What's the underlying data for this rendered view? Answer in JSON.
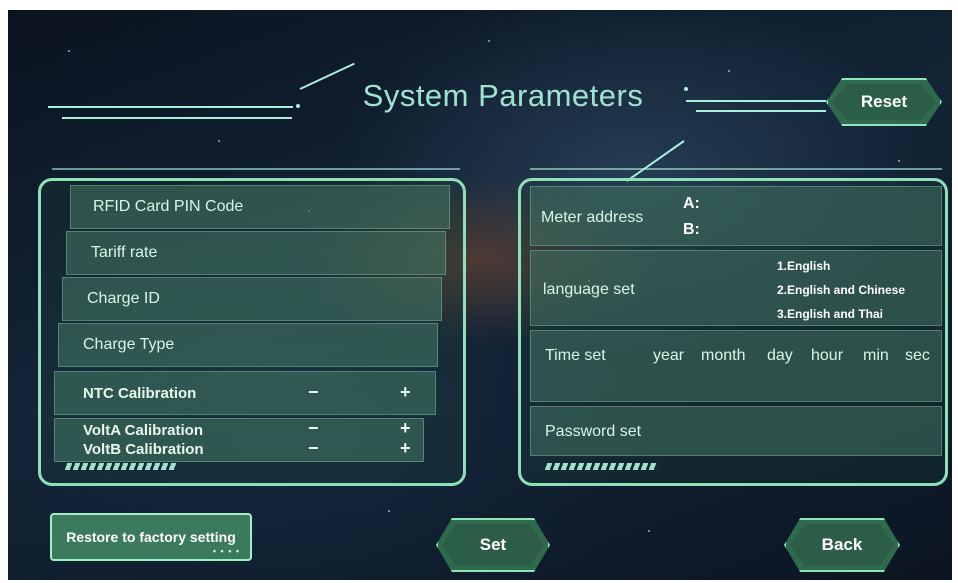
{
  "header": {
    "title": "System Parameters",
    "reset_label": "Reset"
  },
  "left_panel": {
    "rfid": "RFID Card PIN  Code",
    "tariff": "Tariff rate",
    "charge_id": "Charge ID",
    "charge_type": "Charge Type",
    "ntc": "NTC Calibration",
    "volta": "VoltA Calibration",
    "voltb": "VoltB Calibration",
    "minus": "−",
    "plus": "+"
  },
  "right_panel": {
    "meter_address": "Meter address",
    "addr_a": "A:",
    "addr_b": "B:",
    "language_set": "language set",
    "languages": [
      "1.English",
      "2.English and Chinese",
      "3.English and Thai"
    ],
    "time_set": "Time set",
    "time_fields": [
      "year",
      "month",
      "day",
      "hour",
      "min",
      "sec"
    ],
    "password_set": "Password set"
  },
  "footer": {
    "restore_label": "Restore to factory setting",
    "restore_dots": "• • • •",
    "set_label": "Set",
    "back_label": "Back"
  },
  "colors": {
    "accent": "#8fe0b8",
    "title": "#9fe3cf",
    "button_fill": "#2f6a4e"
  }
}
